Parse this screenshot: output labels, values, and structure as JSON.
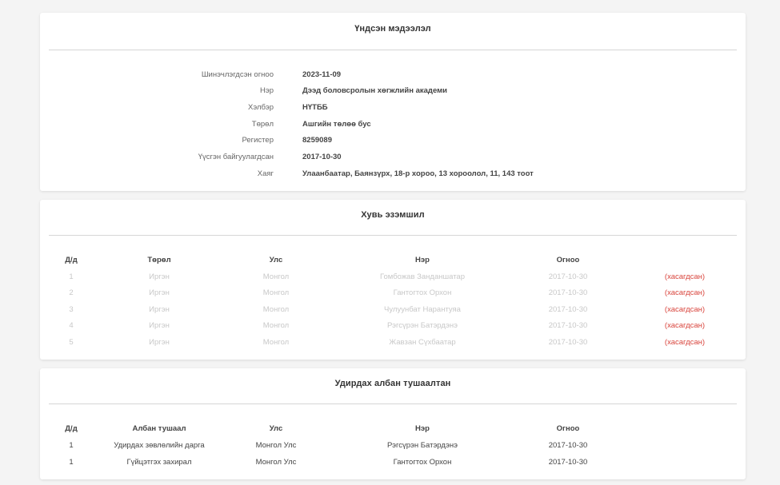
{
  "general": {
    "title": "Үндсэн мэдээлэл",
    "rows": [
      {
        "label": "Шинэчлэгдсэн огноо",
        "value": "2023-11-09"
      },
      {
        "label": "Нэр",
        "value": "Дээд боловсролын хөгжлийн академи"
      },
      {
        "label": "Хэлбэр",
        "value": "НҮТББ"
      },
      {
        "label": "Төрөл",
        "value": "Ашгийн төлөө бус"
      },
      {
        "label": "Регистер",
        "value": "8259089"
      },
      {
        "label": "Үүсгэн байгуулагдсан",
        "value": "2017-10-30"
      },
      {
        "label": "Хаяг",
        "value": "Улаанбаатар, Баянзүрх, 18-р хороо, 13 хороолол, 11, 143 тоот"
      }
    ]
  },
  "owners": {
    "title": "Хувь эзэмшил",
    "headers": [
      "Д/д",
      "Төрөл",
      "Улс",
      "Нэр",
      "Огноо",
      ""
    ],
    "rows": [
      {
        "no": "1",
        "type": "Иргэн",
        "country": "Монгол",
        "name": "Гомбожав Занданшатар",
        "date": "2017-10-30",
        "status": "(хасагдсан)"
      },
      {
        "no": "2",
        "type": "Иргэн",
        "country": "Монгол",
        "name": "Гантогтох Орхон",
        "date": "2017-10-30",
        "status": "(хасагдсан)"
      },
      {
        "no": "3",
        "type": "Иргэн",
        "country": "Монгол",
        "name": "Чулуунбат Нарантуяа",
        "date": "2017-10-30",
        "status": "(хасагдсан)"
      },
      {
        "no": "4",
        "type": "Иргэн",
        "country": "Монгол",
        "name": "Рэгсүрэн Батэрдэнэ",
        "date": "2017-10-30",
        "status": "(хасагдсан)"
      },
      {
        "no": "5",
        "type": "Иргэн",
        "country": "Монгол",
        "name": "Жавзан Сүхбаатар",
        "date": "2017-10-30",
        "status": "(хасагдсан)"
      }
    ]
  },
  "officials": {
    "title": "Удирдах албан тушаалтан",
    "headers": [
      "Д/д",
      "Албан тушаал",
      "Улс",
      "Нэр",
      "Огноо"
    ],
    "rows": [
      {
        "no": "1",
        "position": "Удирдах зөвлөлийн дарга",
        "country": "Монгол Улс",
        "name": "Рэгсүрэн Батэрдэнэ",
        "date": "2017-10-30"
      },
      {
        "no": "1",
        "position": "Гүйцэтгэх захирал",
        "country": "Монгол Улс",
        "name": "Гантогтох Орхон",
        "date": "2017-10-30"
      }
    ]
  },
  "colors": {
    "background": "#f4f4f4",
    "card": "#ffffff",
    "removed": "#d9453d",
    "muted": "#c8c8c8"
  }
}
